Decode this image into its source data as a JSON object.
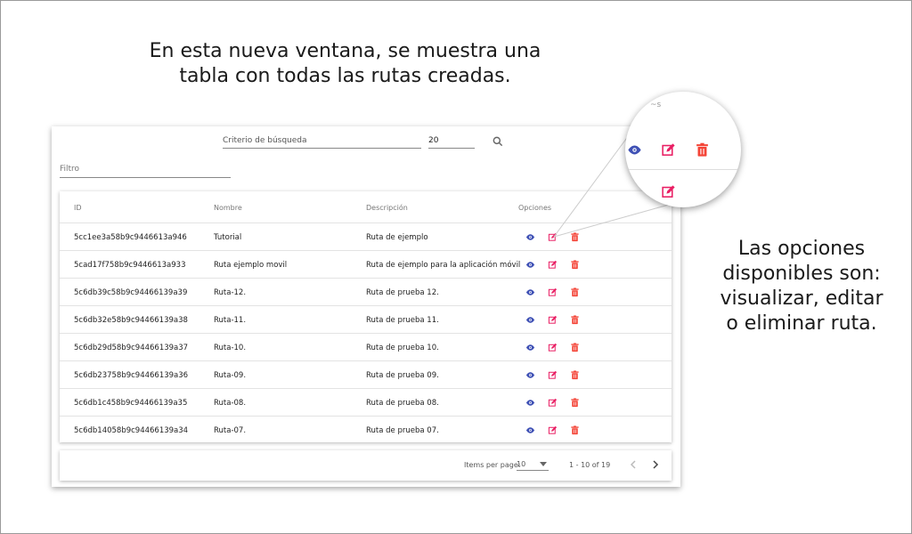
{
  "captions": {
    "top_line1": "En esta nueva ventana, se muestra una",
    "top_line2": "tabla con todas las rutas creadas.",
    "right_line1": "Las opciones",
    "right_line2": "disponibles son:",
    "right_line3": "visualizar, editar",
    "right_line4": "o eliminar ruta."
  },
  "toolbar": {
    "search_placeholder": "Criterio de búsqueda",
    "quantity_value": "20",
    "filter_placeholder": "Filtro"
  },
  "table": {
    "headers": [
      "ID",
      "Nombre",
      "Descripción",
      "Opciones"
    ],
    "rows": [
      {
        "id": "5cc1ee3a58b9c9446613a946",
        "name": "Tutorial",
        "description": "Ruta de ejemplo"
      },
      {
        "id": "5cad17f758b9c9446613a933",
        "name": "Ruta ejemplo movil",
        "description": "Ruta de ejemplo para la aplicación móvil"
      },
      {
        "id": "5c6db39c58b9c94466139a39",
        "name": "Ruta-12.",
        "description": "Ruta de prueba 12."
      },
      {
        "id": "5c6db32e58b9c94466139a38",
        "name": "Ruta-11.",
        "description": "Ruta de prueba 11."
      },
      {
        "id": "5c6db29d58b9c94466139a37",
        "name": "Ruta-10.",
        "description": "Ruta de prueba 10."
      },
      {
        "id": "5c6db23758b9c94466139a36",
        "name": "Ruta-09.",
        "description": "Ruta de prueba 09."
      },
      {
        "id": "5c6db1c458b9c94466139a35",
        "name": "Ruta-08.",
        "description": "Ruta de prueba 08."
      },
      {
        "id": "5c6db14058b9c94466139a34",
        "name": "Ruta-07.",
        "description": "Ruta de prueba 07."
      }
    ]
  },
  "pagination": {
    "items_per_page_label": "Items per page:",
    "items_per_page_value": "10",
    "range": "1 - 10 of 19"
  },
  "icons": {
    "view": "eye-icon",
    "edit": "edit-icon",
    "delete": "delete-icon",
    "search": "search-icon"
  },
  "colors": {
    "view": "#3f51b5",
    "edit": "#e91e63",
    "delete": "#f44336"
  }
}
